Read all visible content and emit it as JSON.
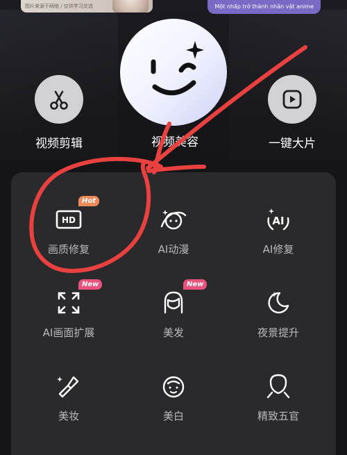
{
  "banner": {
    "left_caption": "图片来源于网络 / 仅供学习交流",
    "right_text": "Một nhấp trở thành nhân vật anime"
  },
  "tools": [
    {
      "label": "视频剪辑",
      "icon": "scissors-icon"
    },
    {
      "label": "视频美容",
      "icon": "smile-face-icon"
    },
    {
      "label": "一键大片",
      "icon": "play-icon"
    }
  ],
  "grid": [
    {
      "label": "画质修复",
      "icon": "hd-icon",
      "badge": "Hot"
    },
    {
      "label": "AI动漫",
      "icon": "anime-face-icon",
      "badge": ""
    },
    {
      "label": "AI修复",
      "icon": "ai-sparkle-icon",
      "badge": ""
    },
    {
      "label": "AI画面扩展",
      "icon": "expand-icon",
      "badge": "New"
    },
    {
      "label": "美发",
      "icon": "hair-icon",
      "badge": "New"
    },
    {
      "label": "夜景提升",
      "icon": "moon-icon",
      "badge": ""
    },
    {
      "label": "美妆",
      "icon": "lipstick-icon",
      "badge": ""
    },
    {
      "label": "美白",
      "icon": "whitening-face-icon",
      "badge": ""
    },
    {
      "label": "精致五官",
      "icon": "face-contour-icon",
      "badge": ""
    }
  ],
  "colors": {
    "background": "#141416",
    "panel": "#2a2a2c",
    "hot_badge": "#ee8a5a",
    "new_badge": "#e8527c",
    "annotation": "#e8413f",
    "banner_pill": "#7b69c6"
  }
}
